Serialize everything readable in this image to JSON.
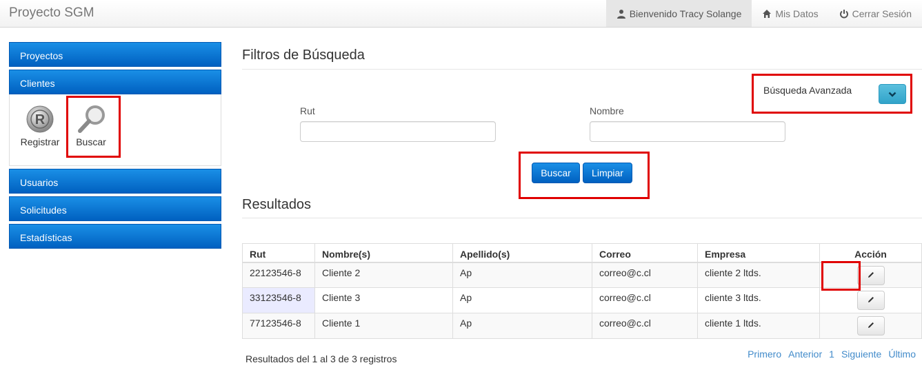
{
  "app": {
    "brand": "Proyecto SGM",
    "nav": {
      "welcome": "Bienvenido Tracy Solange",
      "my_data": "Mis Datos",
      "logout": "Cerrar Sesión"
    }
  },
  "sidebar": {
    "menus": [
      {
        "label": "Proyectos"
      },
      {
        "label": "Clientes"
      },
      {
        "label": "Usuarios"
      },
      {
        "label": "Solicitudes"
      },
      {
        "label": "Estadísticas"
      }
    ],
    "clientes_sub": {
      "registrar": "Registrar",
      "buscar": "Buscar"
    }
  },
  "filters": {
    "title": "Filtros de Búsqueda",
    "advanced_label": "Búsqueda Avanzada",
    "rut_label": "Rut",
    "rut_value": "",
    "nombre_label": "Nombre",
    "nombre_value": "",
    "search_button": "Buscar",
    "clear_button": "Limpiar"
  },
  "results": {
    "title": "Resultados",
    "columns": [
      "Rut",
      "Nombre(s)",
      "Apellido(s)",
      "Correo",
      "Empresa",
      "Acción"
    ],
    "rows": [
      {
        "rut": "22123546-8",
        "nombre": "Cliente 2",
        "apellido": "Ap",
        "correo": "correo@c.cl",
        "empresa": "cliente 2 ltds."
      },
      {
        "rut": "33123546-8",
        "nombre": "Cliente 3",
        "apellido": "Ap",
        "correo": "correo@c.cl",
        "empresa": "cliente 3 ltds."
      },
      {
        "rut": "77123546-8",
        "nombre": "Cliente 1",
        "apellido": "Ap",
        "correo": "correo@c.cl",
        "empresa": "cliente 1 ltds."
      }
    ],
    "info": "Resultados del 1 al 3 de 3 registros",
    "pager": {
      "first": "Primero",
      "prev": "Anterior",
      "page": "1",
      "next": "Siguiente",
      "last": "Último"
    }
  },
  "colors": {
    "primary": "#0060c0",
    "info": "#5bc0de",
    "highlight": "#e00000",
    "rut_cell": "#d3d6ff"
  }
}
